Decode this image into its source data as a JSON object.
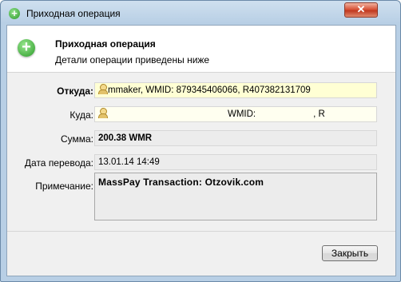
{
  "window": {
    "title": "Приходная операция",
    "close_glyph": "✕"
  },
  "header": {
    "title": "Приходная операция",
    "subtitle": "Детали операции приведены ниже",
    "icon": "plus-circle-icon"
  },
  "form": {
    "from": {
      "label": "Откуда:",
      "value": "mmaker, WMID: 879345406066, R407382131709"
    },
    "to": {
      "label": "Куда:",
      "wmid_label": "WMID:",
      "suffix": ", R"
    },
    "amount": {
      "label": "Сумма:",
      "value": "200.38 WMR"
    },
    "date": {
      "label": "Дата перевода:",
      "value": "13.01.14 14:49"
    },
    "note": {
      "label": "Примечание:",
      "value": "MassPay Transaction: Otzovik.com"
    }
  },
  "footer": {
    "close_label": "Закрыть"
  },
  "colors": {
    "highlight_field": "#ffffd4",
    "accent_green": "#2a9a28"
  }
}
